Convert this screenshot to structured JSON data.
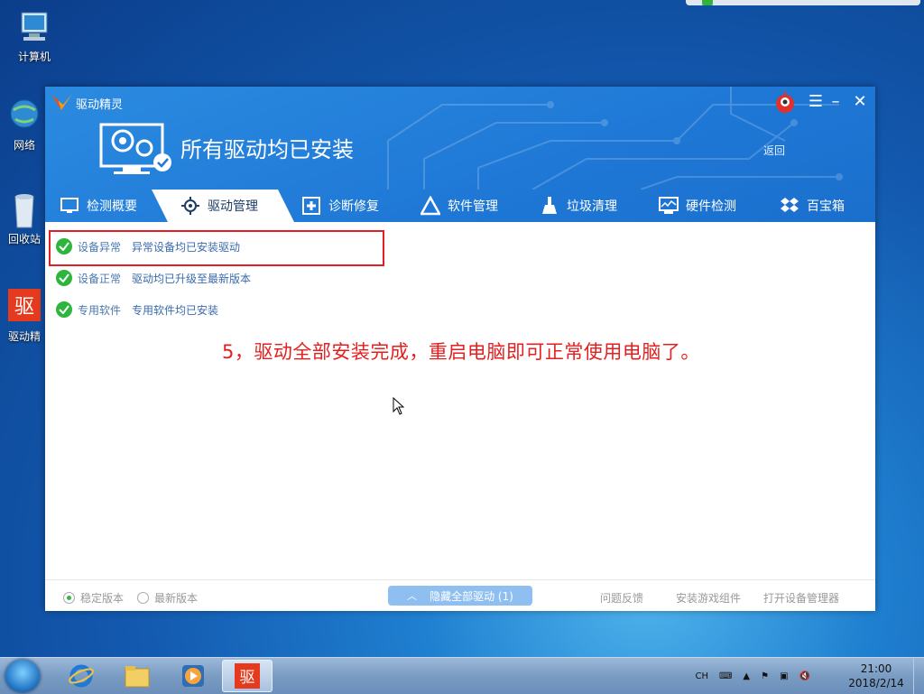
{
  "desktop": {
    "icons": [
      {
        "label": "计算机"
      },
      {
        "label": "网络"
      },
      {
        "label": "回收站"
      },
      {
        "label": "驱动精"
      }
    ]
  },
  "app": {
    "title": "驱动精灵",
    "status_title": "所有驱动均已安装",
    "back_label": "返回",
    "tabs": [
      {
        "label": "检测概要",
        "icon": "monitor-icon"
      },
      {
        "label": "驱动管理",
        "icon": "gear-icon",
        "active": true
      },
      {
        "label": "诊断修复",
        "icon": "first-aid-icon"
      },
      {
        "label": "软件管理",
        "icon": "triangle-app-icon"
      },
      {
        "label": "垃圾清理",
        "icon": "broom-icon"
      },
      {
        "label": "硬件检测",
        "icon": "hardware-monitor-icon"
      },
      {
        "label": "百宝箱",
        "icon": "dropbox-icon"
      }
    ],
    "rows": [
      {
        "category": "设备异常",
        "desc": "异常设备均已安装驱动"
      },
      {
        "category": "设备正常",
        "desc": "驱动均已升级至最新版本"
      },
      {
        "category": "专用软件",
        "desc": "专用软件均已安装"
      }
    ],
    "annotation": "5，驱动全部安装完成，重启电脑即可正常使用电脑了。",
    "footer": {
      "stable_label": "稳定版本",
      "latest_label": "最新版本",
      "hide_button": "隐藏全部驱动 (1)",
      "feedback": "问题反馈",
      "install_game": "安装游戏组件",
      "open_device_mgr": "打开设备管理器"
    }
  },
  "taskbar": {
    "lang": "CH",
    "time": "21:00",
    "date": "2018/2/14"
  },
  "colors": {
    "header_blue": "#1f78d6",
    "annotation_red": "#e51f1f",
    "check_green": "#2db53c"
  }
}
